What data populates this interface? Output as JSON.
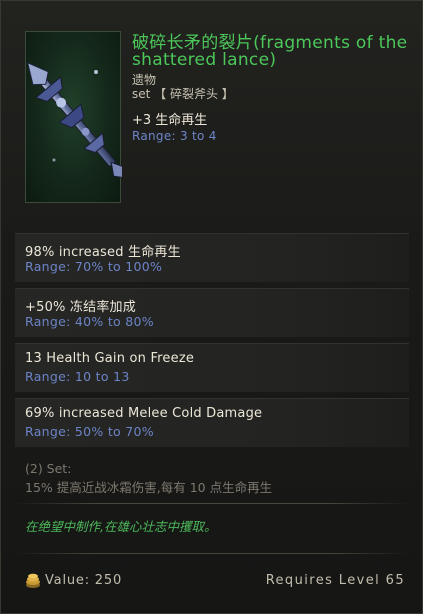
{
  "item": {
    "title": "破碎长矛的裂片(fragments of the shattered lance)",
    "type": "遗物",
    "set_prefix": "set",
    "set_name": "【 碎裂斧头 】",
    "implicit": "+3 生命再生",
    "implicit_range": "Range: 3 to 4",
    "icon": "relic-lance-shard-icon"
  },
  "affixes": [
    {
      "text": "98% increased 生命再生",
      "range": "Range: 70% to 100%"
    },
    {
      "text": "+50% 冻结率加成",
      "range": "Range: 40% to 80%"
    },
    {
      "text": "13 Health Gain on Freeze",
      "range": "Range: 10 to 13"
    },
    {
      "text": "69% increased Melee Cold Damage",
      "range": "Range: 50% to 70%"
    }
  ],
  "set_bonus": {
    "header": "(2) Set:",
    "text": "15% 提高近战冰霜伤害,每有 10 点生命再生"
  },
  "flavor": "在绝望中制作,在雄心壮志中攫取。",
  "footer": {
    "value_label": "Value: 250",
    "requires_label": "Requires Level 65",
    "coin_icon": "gold-coin-icon"
  },
  "colors": {
    "title_green": "#4cc85a",
    "range_blue": "#6c84c8",
    "flavor_green": "#4cb85a"
  }
}
